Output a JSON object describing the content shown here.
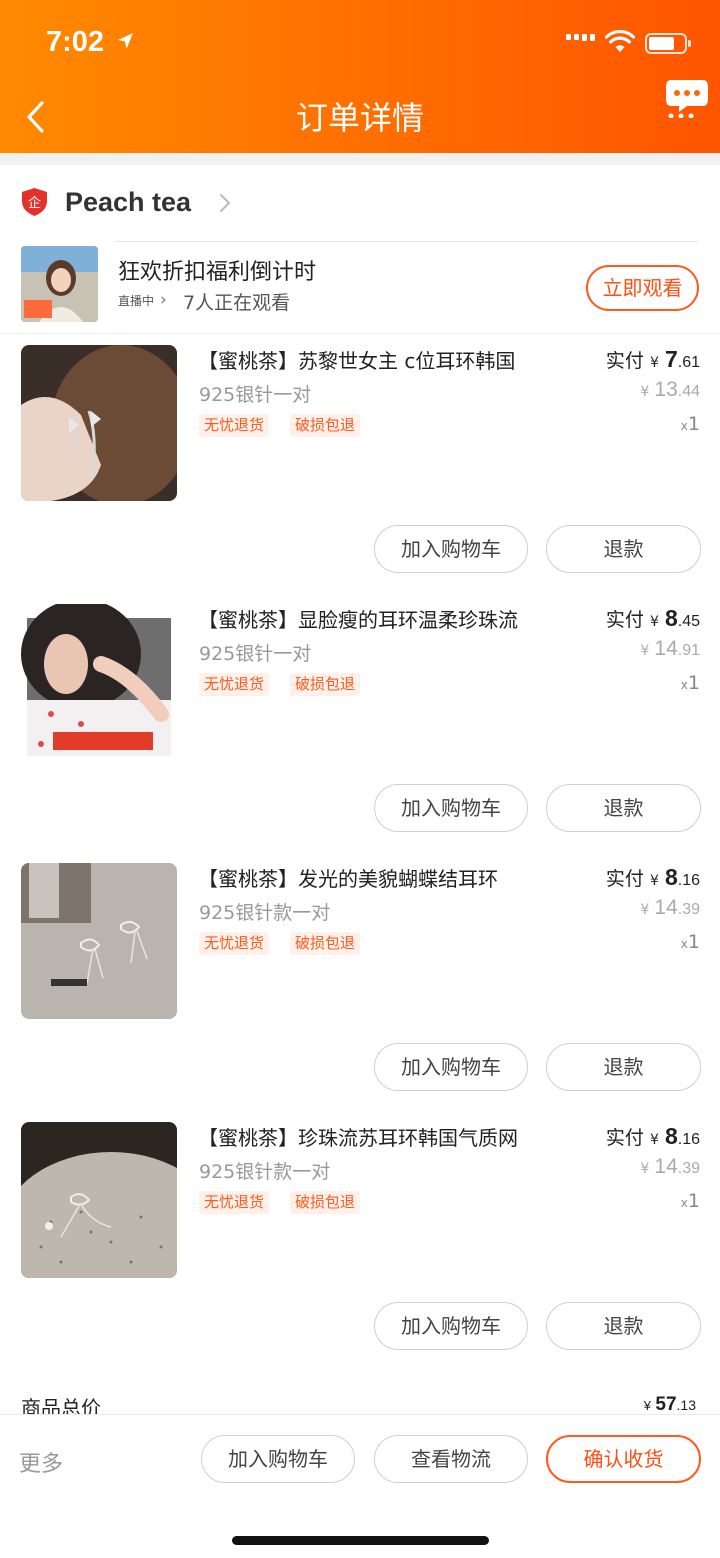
{
  "status_bar": {
    "time": "7:02"
  },
  "header": {
    "title": "订单详情",
    "back_icon": "chevron-left-icon",
    "message_icon": "chat-bubble-icon"
  },
  "store": {
    "name": "Peach tea",
    "badge_icon": "shield-enterprise-icon",
    "badge_char": "企"
  },
  "live": {
    "title": "狂欢折扣福利倒计时",
    "status": "直播中",
    "watching": "7人正在观看",
    "watch_button": "立即观看"
  },
  "items": [
    {
      "title": "【蜜桃茶】苏黎世女主 c位耳环韩国",
      "spec": "925银针一对",
      "tags": [
        "无忧退货",
        "破损包退"
      ],
      "paid_label": "实付",
      "paid_yen": "¥",
      "paid_int": "7",
      "paid_dec": ".61",
      "orig_yen": "¥",
      "orig_int": "13",
      "orig_dec": ".44",
      "qty_x": "x",
      "qty": "1",
      "cart_button": "加入购物车",
      "refund_button": "退款"
    },
    {
      "title": "【蜜桃茶】显脸瘦的耳环温柔珍珠流",
      "spec": "925银针一对",
      "tags": [
        "无忧退货",
        "破损包退"
      ],
      "paid_label": "实付",
      "paid_yen": "¥",
      "paid_int": "8",
      "paid_dec": ".45",
      "orig_yen": "¥",
      "orig_int": "14",
      "orig_dec": ".91",
      "qty_x": "x",
      "qty": "1",
      "cart_button": "加入购物车",
      "refund_button": "退款"
    },
    {
      "title": "【蜜桃茶】发光的美貌蝴蝶结耳环",
      "spec": "925银针款一对",
      "tags": [
        "无忧退货",
        "破损包退"
      ],
      "paid_label": "实付",
      "paid_yen": "¥",
      "paid_int": "8",
      "paid_dec": ".16",
      "orig_yen": "¥",
      "orig_int": "14",
      "orig_dec": ".39",
      "qty_x": "x",
      "qty": "1",
      "cart_button": "加入购物车",
      "refund_button": "退款"
    },
    {
      "title": "【蜜桃茶】珍珠流苏耳环韩国气质网",
      "spec": "925银针款一对",
      "tags": [
        "无忧退货",
        "破损包退"
      ],
      "paid_label": "实付",
      "paid_yen": "¥",
      "paid_int": "8",
      "paid_dec": ".16",
      "orig_yen": "¥",
      "orig_int": "14",
      "orig_dec": ".39",
      "qty_x": "x",
      "qty": "1",
      "cart_button": "加入购物车",
      "refund_button": "退款"
    }
  ],
  "total": {
    "label": "商品总价",
    "yen": "¥",
    "int": "57",
    "dec": ".13"
  },
  "bottom_bar": {
    "more": "更多",
    "cart_button": "加入购物车",
    "logistics_button": "查看物流",
    "confirm_button": "确认收货"
  },
  "colors": {
    "accent": "#ff5a1f",
    "header_start": "#ff8a00",
    "header_end": "#ff5500",
    "tag_bg": "#fff1ea"
  }
}
